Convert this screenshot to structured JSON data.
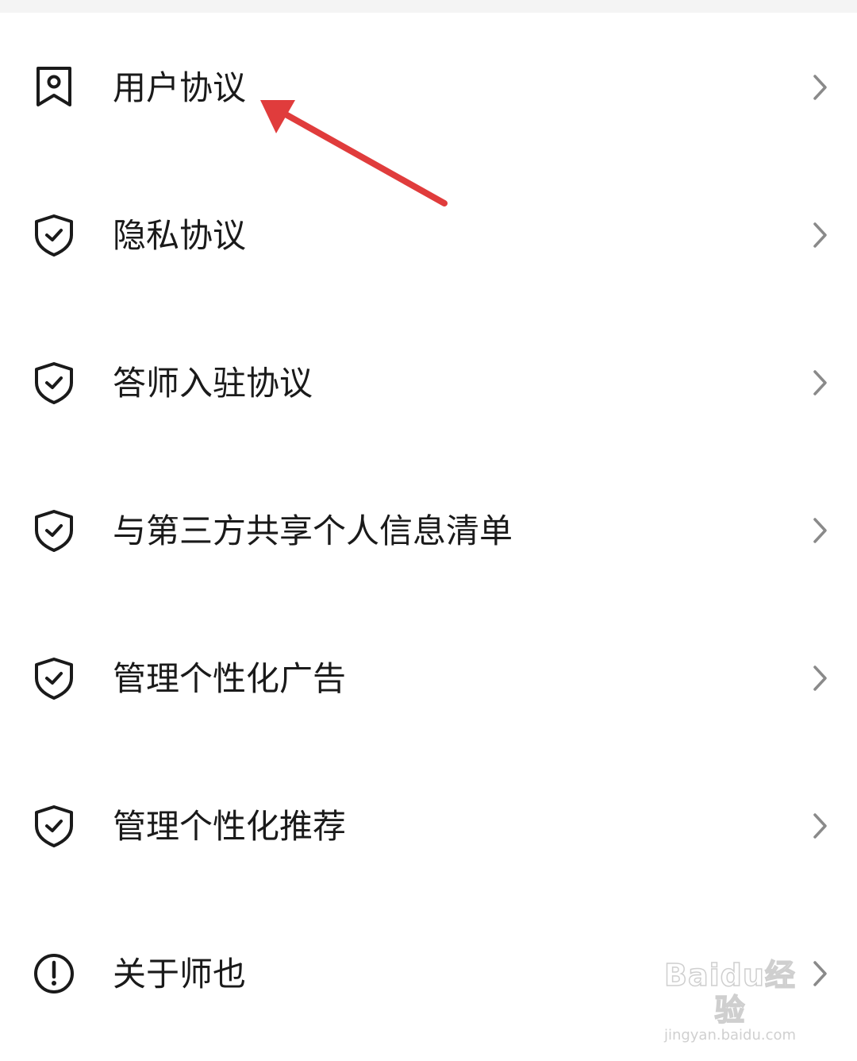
{
  "menu": {
    "items": [
      {
        "label": "用户协议",
        "icon": "bookmark-user-icon"
      },
      {
        "label": "隐私协议",
        "icon": "shield-check-icon"
      },
      {
        "label": "答师入驻协议",
        "icon": "shield-check-icon"
      },
      {
        "label": "与第三方共享个人信息清单",
        "icon": "shield-check-icon"
      },
      {
        "label": "管理个性化广告",
        "icon": "shield-check-icon"
      },
      {
        "label": "管理个性化推荐",
        "icon": "shield-check-icon"
      },
      {
        "label": "关于师也",
        "icon": "info-exclamation-icon"
      }
    ],
    "chevron_icon": "chevron-right-icon"
  },
  "annotation": {
    "arrow_color": "#e03c3c"
  },
  "watermark": {
    "logo_text": "Baidu经验",
    "url": "jingyan.baidu.com"
  },
  "colors": {
    "text": "#1a1a1a",
    "icon_stroke": "#1a1a1a",
    "chevron": "#8a8a8a",
    "background": "#ffffff"
  }
}
